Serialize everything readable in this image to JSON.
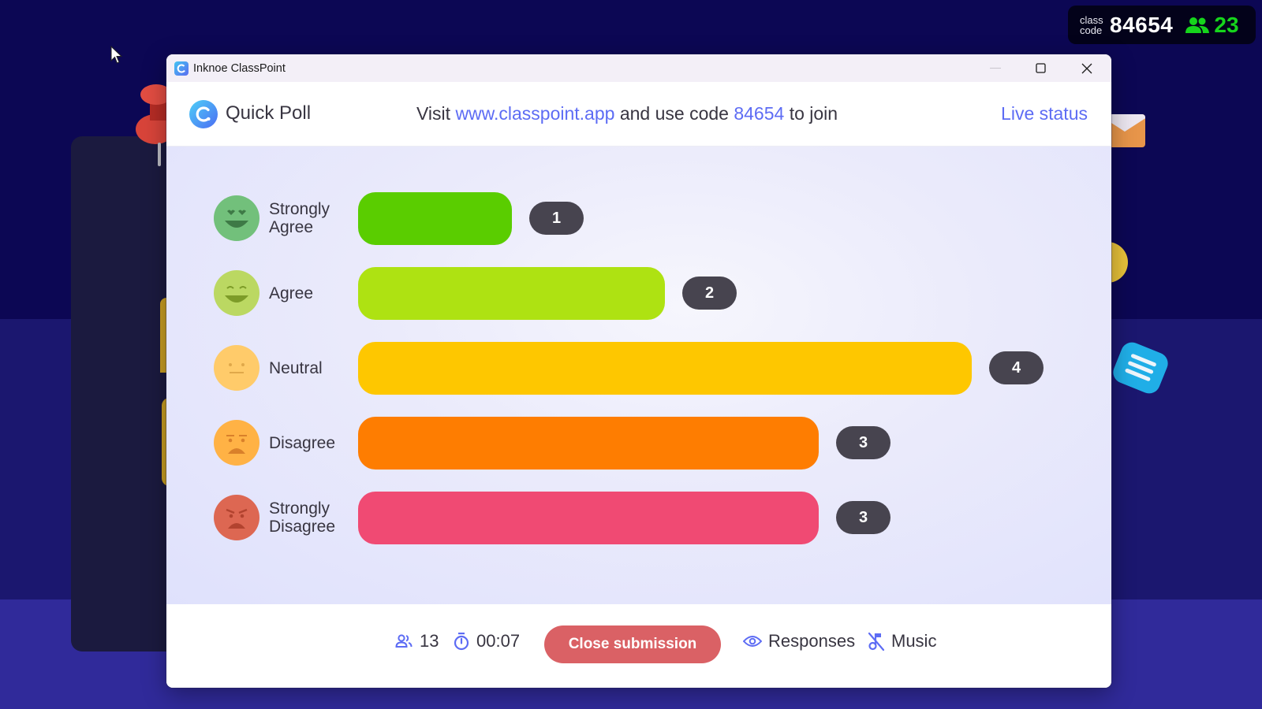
{
  "class_badge": {
    "label_line1": "class",
    "label_line2": "code",
    "code": "84654",
    "participants": "23",
    "participants_color": "#16d51c"
  },
  "window": {
    "title": "Inknoe ClassPoint",
    "controls": [
      "minimize",
      "maximize",
      "close"
    ]
  },
  "header": {
    "poll_title": "Quick Poll",
    "join_prefix": "Visit ",
    "join_url": "www.classpoint.app",
    "join_middle": " and use code ",
    "join_code": "84654",
    "join_suffix": " to join",
    "live_status": "Live status",
    "accent_color": "#5d6cf4"
  },
  "chart_data": {
    "type": "bar",
    "orientation": "horizontal",
    "title": "Quick Poll",
    "categories": [
      "Strongly Agree",
      "Agree",
      "Neutral",
      "Disagree",
      "Strongly Disagree"
    ],
    "label_lines": [
      [
        "Strongly",
        "Agree"
      ],
      [
        "Agree"
      ],
      [
        "Neutral"
      ],
      [
        "Disagree"
      ],
      [
        "Strongly",
        "Disagree"
      ]
    ],
    "values": [
      1,
      2,
      4,
      3,
      3
    ],
    "colors": [
      "#5acd00",
      "#aee212",
      "#fec700",
      "#fe7d01",
      "#f04a73"
    ],
    "faces": [
      "heart-eyes-face-icon",
      "grinning-face-icon",
      "neutral-face-icon",
      "frowning-face-icon",
      "angry-face-icon"
    ],
    "face_colors": [
      "#72c07b",
      "#bbd862",
      "#ffcb6a",
      "#ffb245",
      "#dd6752"
    ],
    "face_feature_colors": [
      "#3e7a46",
      "#7d9c28",
      "#e0a84a",
      "#d9802a",
      "#b2432f"
    ],
    "xlim": [
      0,
      4
    ]
  },
  "footer": {
    "responded": "13",
    "timer": "00:07",
    "close_label": "Close submission",
    "responses_label": "Responses",
    "music_label": "Music"
  }
}
